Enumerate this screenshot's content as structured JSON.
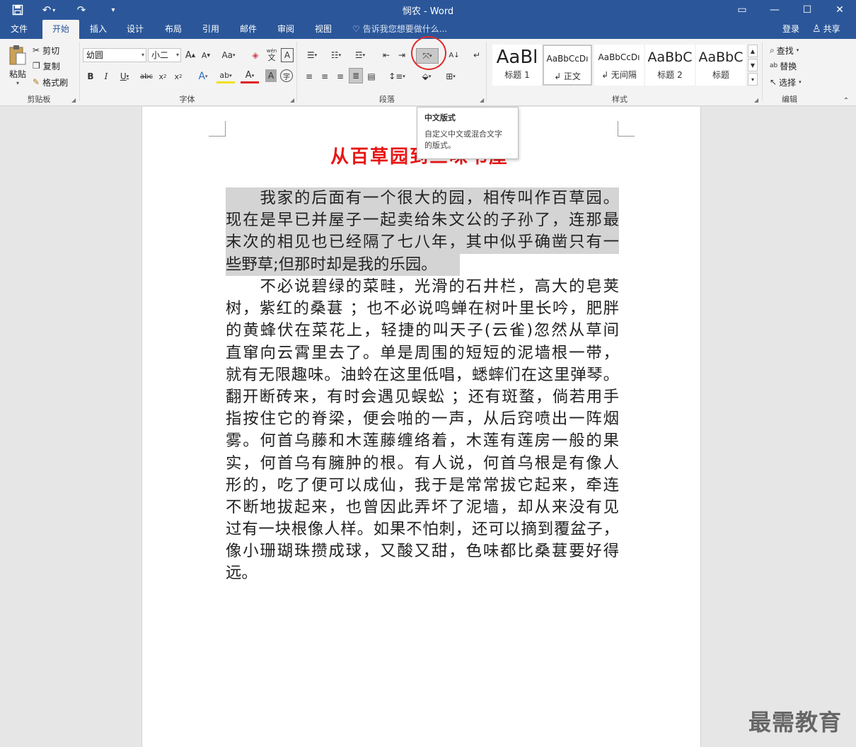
{
  "window": {
    "title": "悯农 - Word",
    "quick_access": {
      "save_icon": "save-icon",
      "undo_icon": "undo-icon",
      "redo_icon": "redo-icon",
      "customize_icon": "customize-icon"
    },
    "controls": {
      "ribbon_display": "▭",
      "minimize": "—",
      "maximize": "☐",
      "close": "✕"
    }
  },
  "tabs": [
    "文件",
    "开始",
    "插入",
    "设计",
    "布局",
    "引用",
    "邮件",
    "审阅",
    "视图"
  ],
  "active_tab": "开始",
  "tell_me": "告诉我您想要做什么...",
  "login": "登录",
  "share": "共享",
  "ribbon": {
    "clipboard": {
      "label": "剪贴板",
      "paste": "粘贴",
      "cut": "剪切",
      "copy": "复制",
      "format_painter": "格式刷"
    },
    "font": {
      "label": "字体",
      "font_name": "幼圆",
      "font_size": "小二"
    },
    "paragraph": {
      "label": "段落"
    },
    "styles": {
      "label": "样式",
      "items": [
        {
          "sample": "AaBl",
          "name": "标题 1"
        },
        {
          "sample": "AaBbCcDı",
          "name": "↲ 正文"
        },
        {
          "sample": "AaBbCcDı",
          "name": "↲ 无间隔"
        },
        {
          "sample": "AaBbC",
          "name": "标题 2"
        },
        {
          "sample": "AaBbC",
          "name": "标题"
        }
      ]
    },
    "editing": {
      "label": "编辑",
      "find": "查找",
      "replace": "替换",
      "select": "选择"
    }
  },
  "tooltip": {
    "title": "中文版式",
    "line1": "自定义中文或混合文字",
    "line2": "的版式。"
  },
  "document": {
    "title": "从百草园到三味书屋",
    "para1": [
      "　　我家的后面有一个很大的园，相传叫作百草园。",
      "现在是早已并屋子一起卖给朱文公的子孙了，连那最",
      "末次的相见也已经隔了七八年，其中似乎确凿只有一",
      "些野草;但那时却是我的乐园。"
    ],
    "para2": [
      "　　不必说碧绿的菜畦，光滑的石井栏，高大的皂荚",
      "树，紫红的桑葚 ；也不必说鸣蝉在树叶里长吟，肥胖",
      "的黄蜂伏在菜花上，轻捷的叫天子(云雀)忽然从草间",
      "直窜向云霄里去了。单是周围的短短的泥墙根一带，",
      "就有无限趣味。油蛉在这里低唱，蟋蟀们在这里弹琴。",
      "翻开断砖来，有时会遇见蜈蚣 ；还有斑蝥，倘若用手",
      "指按住它的脊梁，便会啪的一声，从后窍喷出一阵烟",
      "雾。何首乌藤和木莲藤缠络着，木莲有莲房一般的果",
      "实，何首乌有臃肿的根。有人说，何首乌根是有像人",
      "形的，吃了便可以成仙，我于是常常拔它起来，牵连",
      "不断地拔起来，也曾因此弄坏了泥墙，却从来没有见",
      "过有一块根像人样。如果不怕刺，还可以摘到覆盆子，",
      "像小珊瑚珠攒成球，又酸又甜，色味都比桑葚要好得",
      "远。"
    ]
  },
  "watermark": "最需教育",
  "colors": {
    "brand": "#2b579a",
    "title_red": "#e81717",
    "selection": "#d4d4d4",
    "circle": "#e02b2b"
  }
}
